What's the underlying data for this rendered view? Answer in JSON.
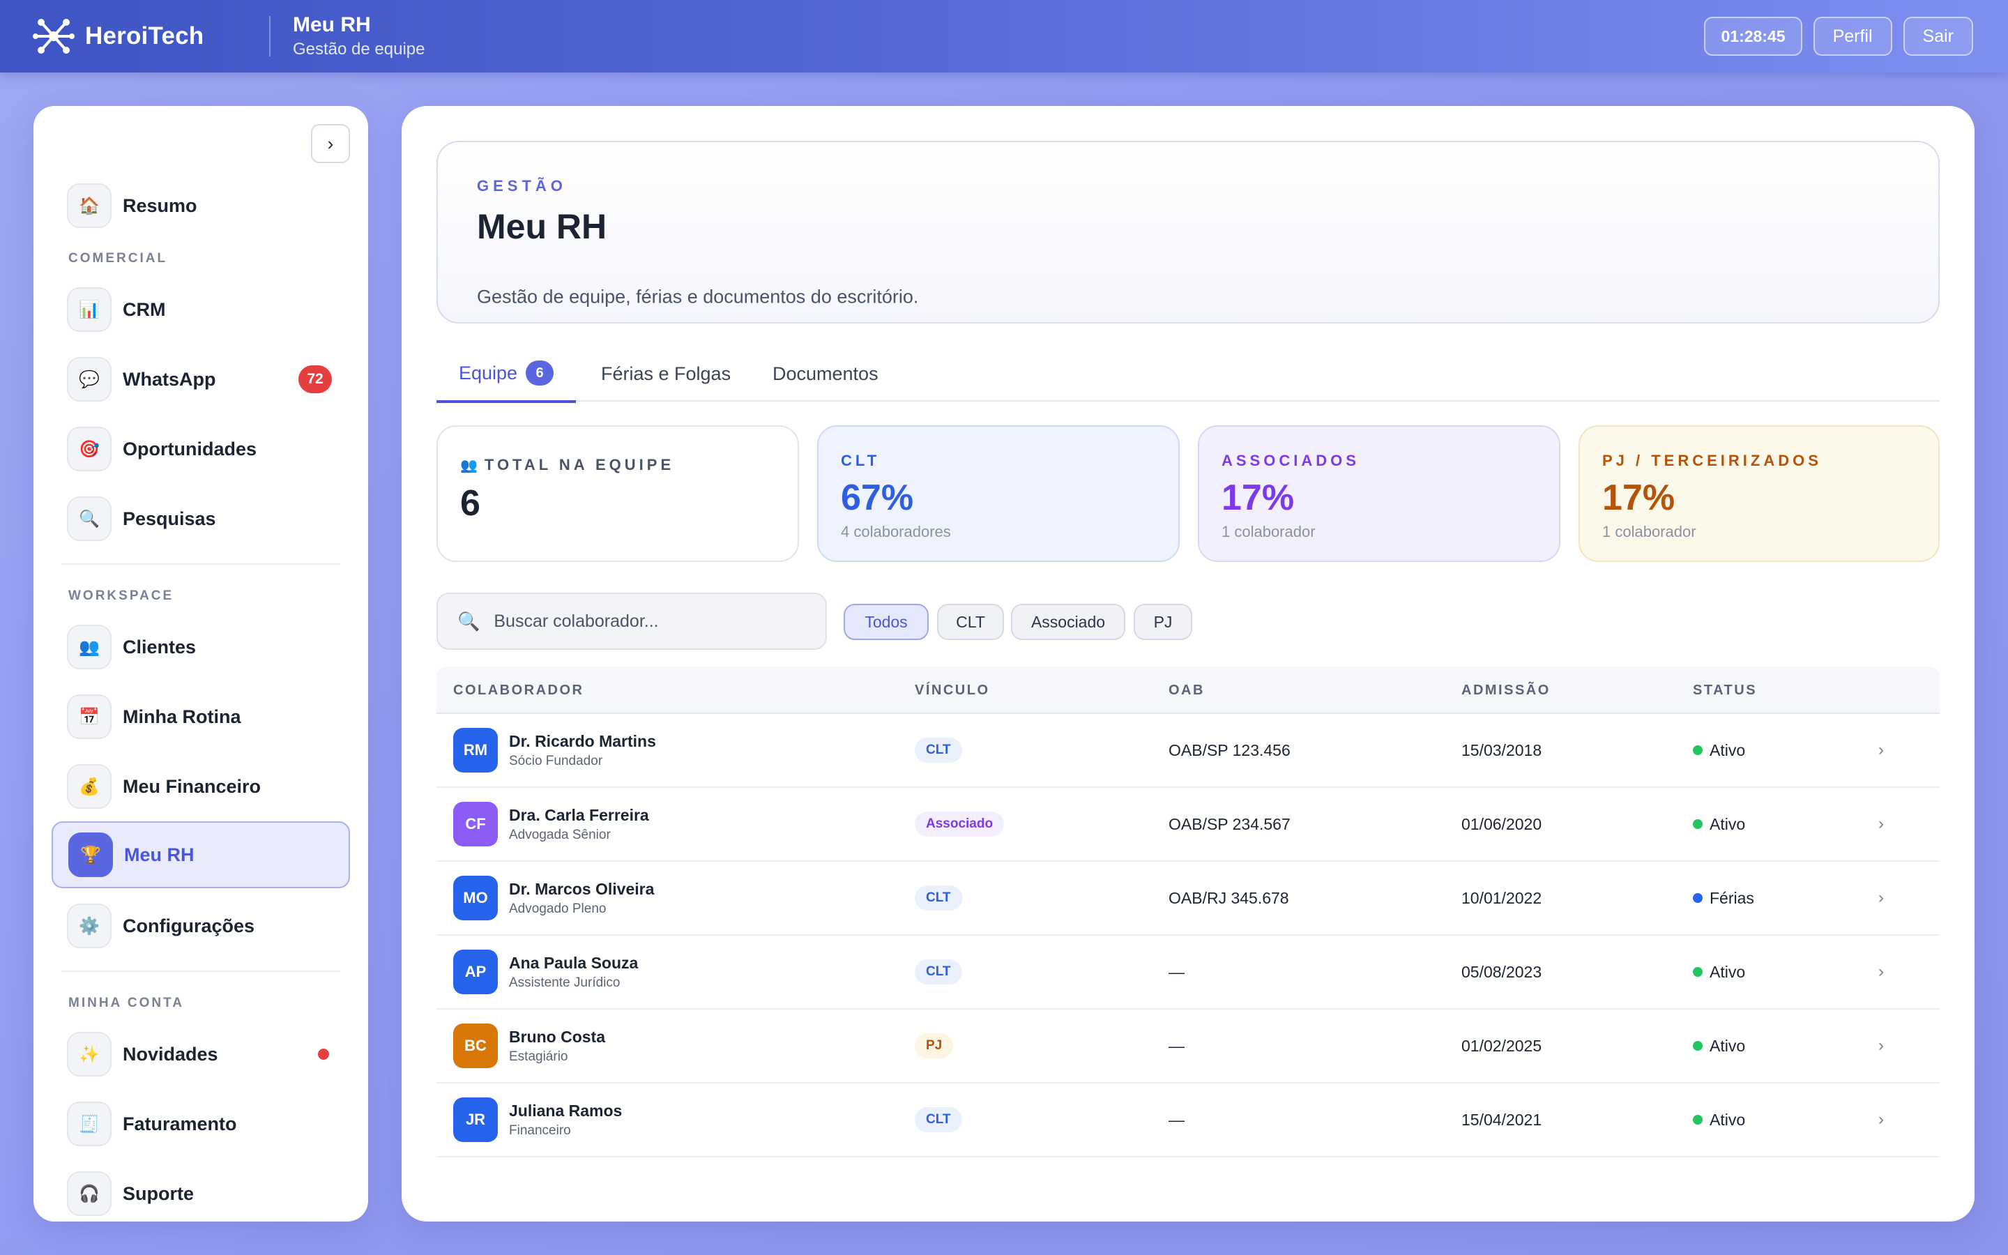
{
  "topbar": {
    "brand": "HeroiTech",
    "title": "Meu RH",
    "subtitle": "Gestão de equipe",
    "timer": "01:28:45",
    "profile_label": "Perfil",
    "logout_label": "Sair"
  },
  "sidebar": {
    "collapse_label": "›",
    "sections": {
      "comercial": "COMERCIAL",
      "workspace": "WORKSPACE",
      "minha_conta": "MINHA CONTA"
    },
    "items": [
      {
        "label": "Resumo",
        "icon": "🏠"
      },
      {
        "label": "CRM",
        "icon": "📊"
      },
      {
        "label": "WhatsApp",
        "icon": "💬",
        "badge": "72"
      },
      {
        "label": "Oportunidades",
        "icon": "🎯"
      },
      {
        "label": "Pesquisas",
        "icon": "🔍"
      },
      {
        "label": "Clientes",
        "icon": "👥"
      },
      {
        "label": "Minha Rotina",
        "icon": "📅"
      },
      {
        "label": "Meu Financeiro",
        "icon": "💰"
      },
      {
        "label": "Meu RH",
        "icon": "🏆",
        "active": true
      },
      {
        "label": "Configurações",
        "icon": "⚙️"
      },
      {
        "label": "Novidades",
        "icon": "✨",
        "dot": true
      },
      {
        "label": "Faturamento",
        "icon": "🧾"
      },
      {
        "label": "Suporte",
        "icon": "🎧"
      }
    ]
  },
  "hero": {
    "kicker": "GESTÃO",
    "title": "Meu RH",
    "description": "Gestão de equipe, férias e documentos do escritório."
  },
  "tabs": [
    {
      "label": "Equipe",
      "count": "6",
      "active": true
    },
    {
      "label": "Férias e Folgas"
    },
    {
      "label": "Documentos"
    }
  ],
  "stats": [
    {
      "label": "TOTAL NA EQUIPE",
      "icon": "👥",
      "value": "6",
      "sub": ""
    },
    {
      "label": "CLT",
      "value": "67%",
      "sub": "4 colaboradores"
    },
    {
      "label": "ASSOCIADOS",
      "value": "17%",
      "sub": "1 colaborador"
    },
    {
      "label": "PJ / TERCEIRIZADOS",
      "value": "17%",
      "sub": "1 colaborador"
    }
  ],
  "colors": {
    "accent": "#4a56d8",
    "clt": "#2f5ee0",
    "associado": "#7c3aed",
    "pj": "#b45309",
    "ativo": "#22c55e",
    "ferias": "#2563eb"
  },
  "search": {
    "placeholder": "Buscar colaborador...",
    "icon": "search-icon"
  },
  "filters": [
    "Todos",
    "CLT",
    "Associado",
    "PJ"
  ],
  "table": {
    "headers": [
      "COLABORADOR",
      "VÍNCULO",
      "OAB",
      "ADMISSÃO",
      "STATUS"
    ],
    "rows": [
      {
        "initials": "RM",
        "name": "Dr. Ricardo Martins",
        "role": "Sócio Fundador",
        "vinculo": "CLT",
        "oab": "OAB/SP 123.456",
        "admissao": "15/03/2018",
        "status": "Ativo",
        "avatar_color": "#2563eb"
      },
      {
        "initials": "CF",
        "name": "Dra. Carla Ferreira",
        "role": "Advogada Sênior",
        "vinculo": "Associado",
        "oab": "OAB/SP 234.567",
        "admissao": "01/06/2020",
        "status": "Ativo",
        "avatar_color": "#8b5cf6"
      },
      {
        "initials": "MO",
        "name": "Dr. Marcos Oliveira",
        "role": "Advogado Pleno",
        "vinculo": "CLT",
        "oab": "OAB/RJ 345.678",
        "admissao": "10/01/2022",
        "status": "Férias",
        "avatar_color": "#2563eb"
      },
      {
        "initials": "AP",
        "name": "Ana Paula Souza",
        "role": "Assistente Jurídico",
        "vinculo": "CLT",
        "oab": "—",
        "admissao": "05/08/2023",
        "status": "Ativo",
        "avatar_color": "#2563eb"
      },
      {
        "initials": "BC",
        "name": "Bruno Costa",
        "role": "Estagiário",
        "vinculo": "PJ",
        "oab": "—",
        "admissao": "01/02/2025",
        "status": "Ativo",
        "avatar_color": "#d97706"
      },
      {
        "initials": "JR",
        "name": "Juliana Ramos",
        "role": "Financeiro",
        "vinculo": "CLT",
        "oab": "—",
        "admissao": "15/04/2021",
        "status": "Ativo",
        "avatar_color": "#2563eb"
      }
    ]
  }
}
